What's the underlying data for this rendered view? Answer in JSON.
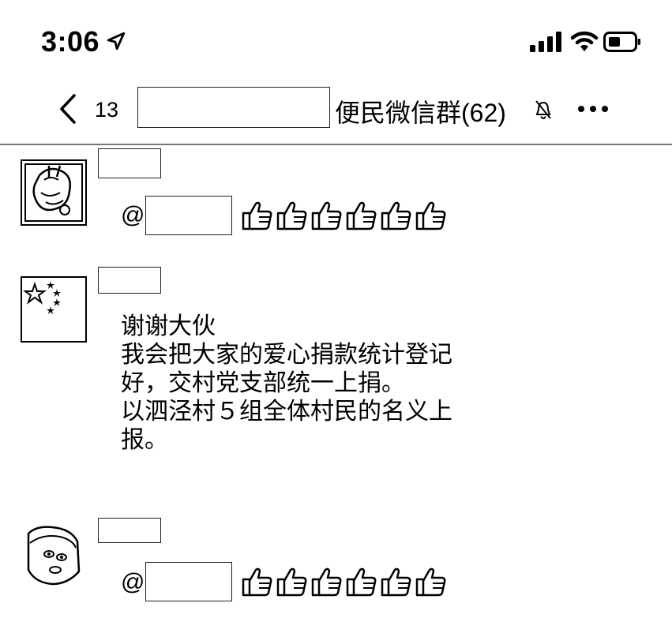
{
  "status_bar": {
    "time": "3:06",
    "location_icon": "location-arrow-icon",
    "signal_icon": "cellular-signal-icon",
    "wifi_icon": "wifi-icon",
    "battery_icon": "battery-icon"
  },
  "nav": {
    "back_icon": "chevron-left-icon",
    "unread_count": "13",
    "group_title": "便民微信群(62)",
    "mute_icon": "bell-slash-icon",
    "more_icon": "ellipsis-icon"
  },
  "messages": [
    {
      "sender": "",
      "at_symbol": "@",
      "thumbs_count": 6
    },
    {
      "sender": "",
      "lines": [
        "谢谢大伙",
        "我会把大家的爱心捐款统计登记",
        "好，交村党支部统一上捐。",
        "以泗泾村５组全体村民的名义上",
        "报。"
      ]
    },
    {
      "sender": "",
      "at_symbol": "@",
      "thumbs_count": 6
    }
  ]
}
